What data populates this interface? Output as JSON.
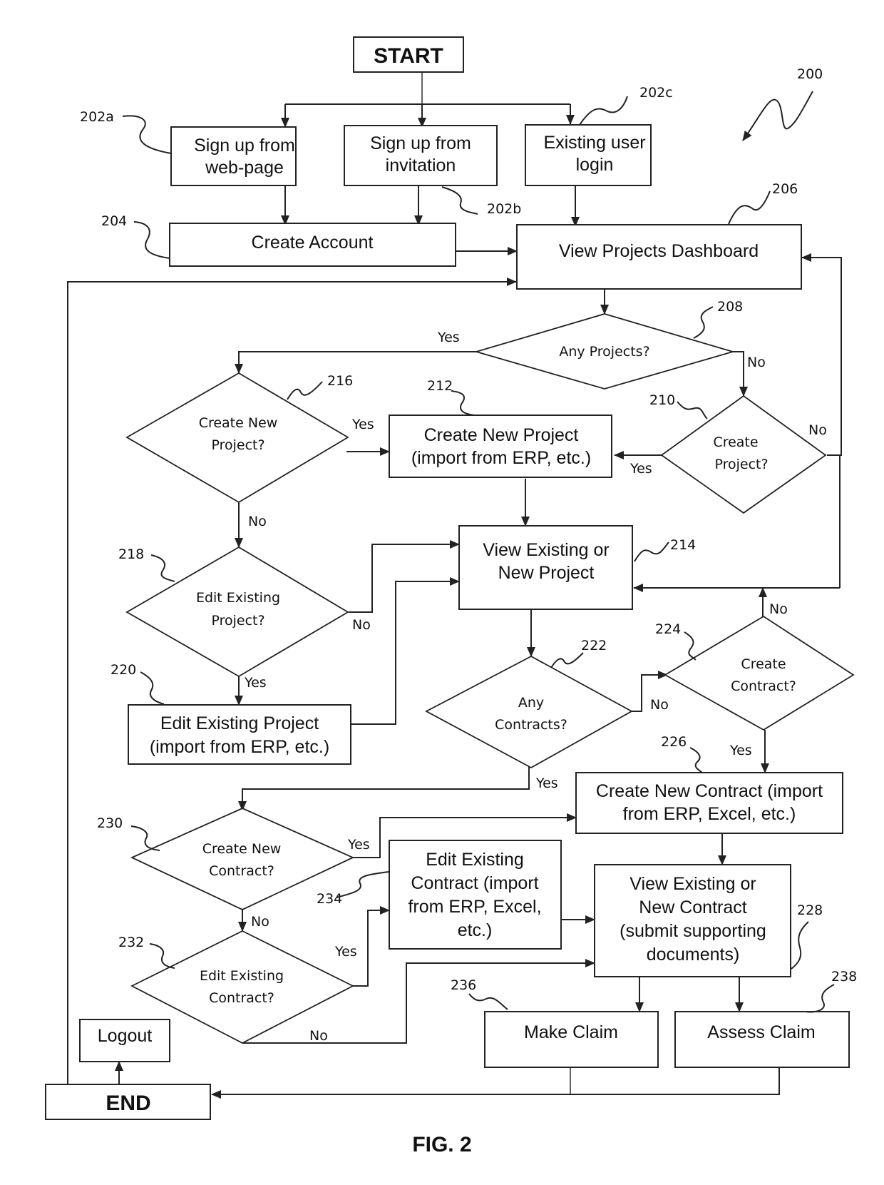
{
  "figure": {
    "caption": "FIG. 2",
    "ref": "200"
  },
  "nodes": {
    "start": {
      "label": "START"
    },
    "signup_web": {
      "lines": [
        "Sign up from",
        "web-page"
      ],
      "ref": "202a"
    },
    "signup_invite": {
      "lines": [
        "Sign up from",
        "invitation"
      ],
      "ref": "202b"
    },
    "existing_login": {
      "lines": [
        "Existing user",
        "login"
      ],
      "ref": "202c"
    },
    "create_account": {
      "label": "Create Account",
      "ref": "204"
    },
    "dashboard": {
      "label": "View Projects Dashboard",
      "ref": "206"
    },
    "any_projects": {
      "label": "Any Projects?",
      "ref": "208"
    },
    "create_project_q": {
      "lines": [
        "Create",
        "Project?"
      ],
      "ref": "210"
    },
    "create_new_project": {
      "lines": [
        "Create New Project",
        "(import from ERP, etc.)"
      ],
      "ref": "212"
    },
    "view_project": {
      "lines": [
        "View Existing or",
        "New Project"
      ],
      "ref": "214"
    },
    "create_new_project_q": {
      "lines": [
        "Create New",
        "Project?"
      ],
      "ref": "216"
    },
    "edit_project_q": {
      "lines": [
        "Edit Existing",
        "Project?"
      ],
      "ref": "218"
    },
    "edit_project": {
      "lines": [
        "Edit Existing Project",
        "(import from ERP, etc.)"
      ],
      "ref": "220"
    },
    "any_contracts": {
      "lines": [
        "Any",
        "Contracts?"
      ],
      "ref": "222"
    },
    "create_contract_q": {
      "lines": [
        "Create",
        "Contract?"
      ],
      "ref": "224"
    },
    "create_new_contract": {
      "lines": [
        "Create New Contract (import",
        "from ERP, Excel, etc.)"
      ],
      "ref": "226"
    },
    "view_contract": {
      "lines": [
        "View Existing or",
        "New Contract",
        "(submit supporting",
        "documents)"
      ],
      "ref": "228"
    },
    "create_new_contract_q": {
      "lines": [
        "Create New",
        "Contract?"
      ],
      "ref": "230"
    },
    "edit_contract_q": {
      "lines": [
        "Edit Existing",
        "Contract?"
      ],
      "ref": "232"
    },
    "edit_contract": {
      "lines": [
        "Edit Existing",
        "Contract (import",
        "from ERP, Excel,",
        "etc.)"
      ],
      "ref": "234"
    },
    "make_claim": {
      "label": "Make Claim",
      "ref": "236"
    },
    "assess_claim": {
      "label": "Assess Claim",
      "ref": "238"
    },
    "logout": {
      "label": "Logout"
    },
    "end": {
      "label": "END"
    }
  },
  "edge_labels": {
    "any_projects_yes": "Yes",
    "any_projects_no": "No",
    "create_new_project_yes": "Yes",
    "create_new_project_no": "No",
    "create_project_yes": "Yes",
    "create_project_no": "No",
    "edit_project_yes": "Yes",
    "edit_project_no": "No",
    "any_contracts_yes": "Yes",
    "any_contracts_no": "No",
    "create_contract_yes": "Yes",
    "create_contract_no": "No",
    "create_new_contract_yes": "Yes",
    "create_new_contract_no": "No",
    "edit_contract_yes": "Yes",
    "edit_contract_no": "No"
  }
}
